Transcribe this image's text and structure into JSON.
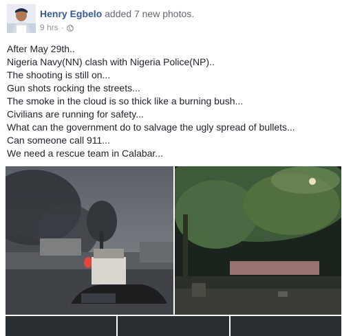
{
  "post": {
    "author": "Henry Egbelo",
    "action": "added 7 new photos.",
    "time": "9 hrs",
    "separator": "·",
    "privacy_icon": "globe-icon",
    "lines": [
      "After May 29th..",
      "Nigeria Navy(NN) clash with Nigeria Police(NP)..",
      "The shooting is still on...",
      "Gun shots rocking the streets...",
      "The smoke in the cloud is so thick like a burning bush...",
      "Civilians are running for safety...",
      "What can the government do to salvage the ugly spread of bullets...",
      "Can someone call 911...",
      "We need a rescue team in Calabar..."
    ]
  },
  "colors": {
    "link": "#365899",
    "meta": "#90949c",
    "text": "#1d2129"
  }
}
